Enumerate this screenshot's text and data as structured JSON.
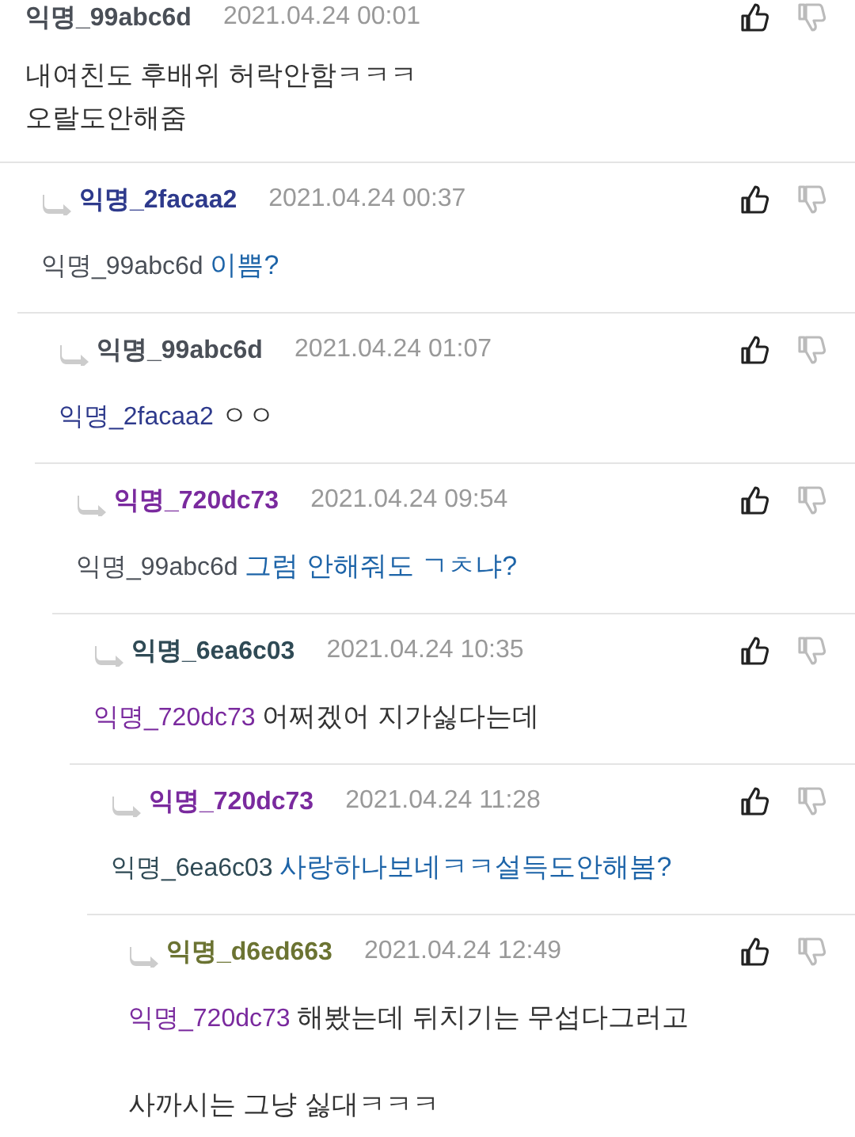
{
  "comments": [
    {
      "author": "익명_99abc6d",
      "color": "#4a4f57",
      "time": "2021.04.24 00:01",
      "text": "내여친도 후배위 허락안함ㅋㅋㅋ\n오랄도안해줌",
      "emphasis": false,
      "children": [
        {
          "author": "익명_2facaa2",
          "color": "#2e3a8c",
          "time": "2021.04.24 00:37",
          "mention": "익명_99abc6d",
          "text": "이쁨?",
          "emphasis": true,
          "children": [
            {
              "author": "익명_99abc6d",
              "color": "#4a4f57",
              "time": "2021.04.24 01:07",
              "mention": "익명_2facaa2",
              "text": "ㅇㅇ",
              "emphasis": false,
              "children": [
                {
                  "author": "익명_720dc73",
                  "color": "#7a2a9e",
                  "time": "2021.04.24 09:54",
                  "mention": "익명_99abc6d",
                  "text": "그럼 안해줘도 ㄱㅊ냐?",
                  "emphasis": true,
                  "children": [
                    {
                      "author": "익명_6ea6c03",
                      "color": "#2f4a55",
                      "time": "2021.04.24 10:35",
                      "mention": "익명_720dc73",
                      "text": "어쩌겠어 지가싫다는데",
                      "emphasis": false,
                      "children": [
                        {
                          "author": "익명_720dc73",
                          "color": "#7a2a9e",
                          "time": "2021.04.24 11:28",
                          "mention": "익명_6ea6c03",
                          "text": "사랑하나보네ㅋㅋ설득도안해봄?",
                          "emphasis": true,
                          "children": [
                            {
                              "author": "익명_d6ed663",
                              "color": "#6b7332",
                              "time": "2021.04.24 12:49",
                              "mention": "익명_720dc73",
                              "text": "해봤는데 뒤치기는 무섭다그러고\n\n사까시는 그냥 싫대ㅋㅋㅋ",
                              "emphasis": false
                            }
                          ]
                        }
                      ]
                    }
                  ]
                }
              ]
            }
          ]
        }
      ]
    }
  ]
}
